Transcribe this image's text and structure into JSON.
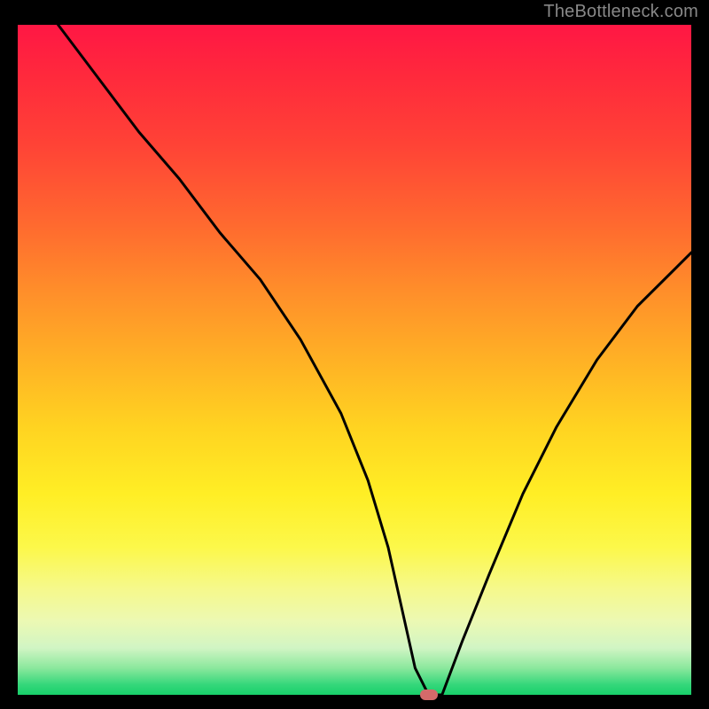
{
  "watermark": "TheBottleneck.com",
  "chart_data": {
    "type": "line",
    "title": "",
    "xlabel": "",
    "ylabel": "",
    "xlim": [
      0,
      100
    ],
    "ylim": [
      0,
      100
    ],
    "grid": false,
    "legend": false,
    "background_gradient": {
      "top_color": "#ff1744",
      "mid_color": "#ffee25",
      "bottom_color": "#18cf6a"
    },
    "series": [
      {
        "name": "bottleneck-curve",
        "color": "#000000",
        "x": [
          6,
          12,
          18,
          24,
          30,
          36,
          42,
          48,
          52,
          55,
          57,
          59,
          61,
          63,
          66,
          70,
          75,
          80,
          86,
          92,
          98,
          100
        ],
        "values": [
          100,
          92,
          84,
          77,
          69,
          62,
          53,
          42,
          32,
          22,
          13,
          4,
          0,
          0,
          8,
          18,
          30,
          40,
          50,
          58,
          64,
          66
        ]
      }
    ],
    "marker": {
      "x": 61,
      "y": 0,
      "color": "#d46a6a"
    }
  }
}
